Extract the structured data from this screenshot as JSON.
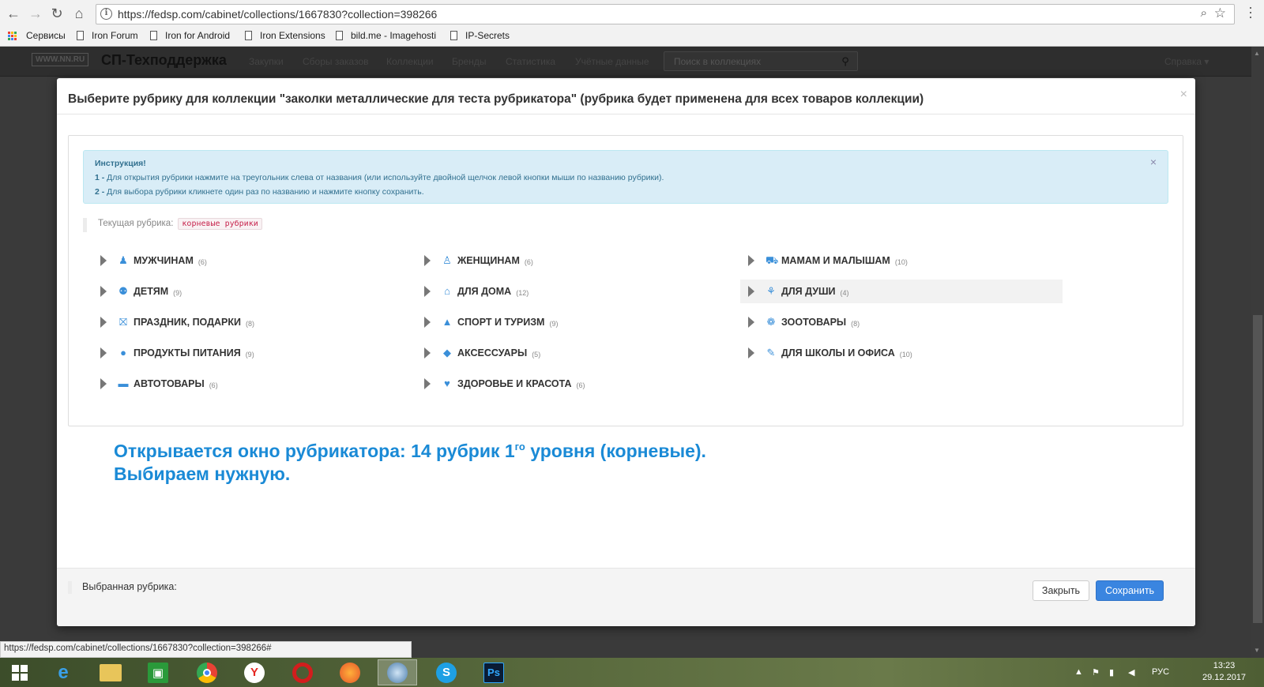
{
  "browser": {
    "url": "https://fedsp.com/cabinet/collections/1667830?collection=398266",
    "bookmarks": [
      "Сервисы",
      "Iron Forum",
      "Iron for Android",
      "Iron Extensions",
      "bild.me - Imagehosti",
      "IP-Secrets"
    ]
  },
  "site": {
    "logo": "WWW.NN.RU",
    "title": "СП-Техподдержка",
    "nav": [
      "Закупки",
      "Сборы заказов",
      "Коллекции",
      "Бренды",
      "Статистика",
      "Учётные данные"
    ],
    "search_placeholder": "Поиск в коллекциях",
    "help": "Справка ▾"
  },
  "modal": {
    "title": "Выберите рубрику для коллекции \"заколки металлические для теста рубрикатора\" (рубрика будет применена для всех товаров коллекции)",
    "close": "×",
    "alert": {
      "head": "Инструкция!",
      "line1_num": "1 -",
      "line1": " Для открытия рубрики нажмите на треугольник слева от названия (или используйте двойной щелчок левой кнопки мыши по названию рубрики).",
      "line2_num": "2 -",
      "line2": " Для выбора рубрики кликнете один раз по названию и нажмите кнопку сохранить.",
      "close": "×"
    },
    "current_label": "Текущая рубрика:",
    "current_value": "корневые рубрики",
    "categories": [
      {
        "name": "МУЖЧИНАМ",
        "count": "(6)",
        "icon": "man-icon"
      },
      {
        "name": "ЖЕНЩИНАМ",
        "count": "(6)",
        "icon": "woman-icon"
      },
      {
        "name": "МАМАМ И МАЛЫШАМ",
        "count": "(10)",
        "icon": "stroller-icon"
      },
      {
        "name": "ДЕТЯМ",
        "count": "(9)",
        "icon": "children-icon"
      },
      {
        "name": "ДЛЯ ДОМА",
        "count": "(12)",
        "icon": "home-icon"
      },
      {
        "name": "ДЛЯ ДУШИ",
        "count": "(4)",
        "icon": "soul-icon"
      },
      {
        "name": "ПРАЗДНИК, ПОДАРКИ",
        "count": "(8)",
        "icon": "gift-icon"
      },
      {
        "name": "СПОРТ И ТУРИЗМ",
        "count": "(9)",
        "icon": "tent-icon"
      },
      {
        "name": "ЗООТОВАРЫ",
        "count": "(8)",
        "icon": "paw-icon"
      },
      {
        "name": "ПРОДУКТЫ ПИТАНИЯ",
        "count": "(9)",
        "icon": "apple-icon"
      },
      {
        "name": "АКСЕССУАРЫ",
        "count": "(5)",
        "icon": "accessories-icon"
      },
      {
        "name": "ДЛЯ ШКОЛЫ И ОФИСА",
        "count": "(10)",
        "icon": "pin-icon"
      },
      {
        "name": "АВТОТОВАРЫ",
        "count": "(6)",
        "icon": "car-icon"
      },
      {
        "name": "ЗДОРОВЬЕ И КРАСОТА",
        "count": "(6)",
        "icon": "heart-icon"
      }
    ],
    "annotation_line1_a": "Открывается окно рубрикатора: 14 рубрик 1",
    "annotation_sup": "го",
    "annotation_line1_b": " уровня (корневые).",
    "annotation_line2": "Выбираем нужную.",
    "selected_label": "Выбранная рубрика:",
    "btn_close": "Закрыть",
    "btn_save": "Сохранить"
  },
  "status_bar": "https://fedsp.com/cabinet/collections/1667830?collection=398266#",
  "taskbar": {
    "lang": "РУС",
    "time": "13:23",
    "date": "29.12.2017"
  },
  "colors": {
    "accent": "#3a8fd9",
    "annotation": "#1a8ad6",
    "save_button": "#3a85e0",
    "alert_bg": "#d9edf7"
  }
}
